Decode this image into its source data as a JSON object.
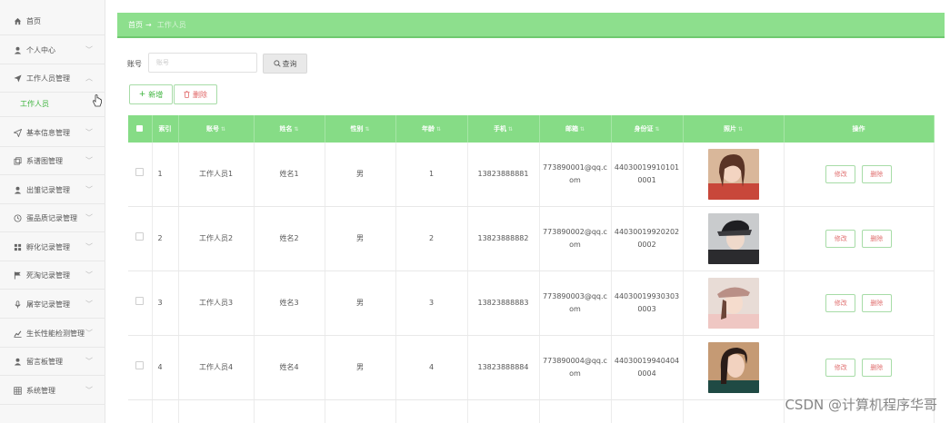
{
  "sidebar": {
    "items": [
      {
        "label": "首页",
        "icon": "home-icon",
        "chevron": false
      },
      {
        "label": "个人中心",
        "icon": "user-icon",
        "chevron": true
      },
      {
        "label": "工作人员管理",
        "icon": "send-icon",
        "chevron": true,
        "expanded": true
      },
      {
        "label": "基本信息管理",
        "icon": "send-outline-icon",
        "chevron": true
      },
      {
        "label": "系谱图管理",
        "icon": "copy-icon",
        "chevron": true
      },
      {
        "label": "出雏记录管理",
        "icon": "user-icon",
        "chevron": true
      },
      {
        "label": "蛋品质记录管理",
        "icon": "clock-icon",
        "chevron": true
      },
      {
        "label": "孵化记录管理",
        "icon": "grid-icon",
        "chevron": true
      },
      {
        "label": "死淘记录管理",
        "icon": "flag-icon",
        "chevron": true
      },
      {
        "label": "屠宰记录管理",
        "icon": "mic-icon",
        "chevron": true
      },
      {
        "label": "生长性能检测管理",
        "icon": "chart-icon",
        "chevron": true
      },
      {
        "label": "留言板管理",
        "icon": "user-icon",
        "chevron": true
      },
      {
        "label": "系统管理",
        "icon": "table-icon",
        "chevron": true
      }
    ],
    "sub_item": "工作人员"
  },
  "breadcrumb": {
    "home": "首页",
    "arrow": "→",
    "current": "工作人员"
  },
  "search": {
    "label": "账号",
    "placeholder": "账号",
    "button": "查询"
  },
  "toolbar": {
    "add": "新增",
    "delete": "删除"
  },
  "table": {
    "columns": [
      "索引",
      "账号",
      "姓名",
      "性别",
      "年龄",
      "手机",
      "邮箱",
      "身份证",
      "照片",
      "操作"
    ],
    "rows": [
      {
        "index": "1",
        "account": "工作人员1",
        "name": "姓名1",
        "gender": "男",
        "age": "1",
        "phone": "13823888881",
        "email": "773890001@qq.com",
        "idcard": "440300199101010001"
      },
      {
        "index": "2",
        "account": "工作人员2",
        "name": "姓名2",
        "gender": "男",
        "age": "2",
        "phone": "13823888882",
        "email": "773890002@qq.com",
        "idcard": "440300199202020002"
      },
      {
        "index": "3",
        "account": "工作人员3",
        "name": "姓名3",
        "gender": "男",
        "age": "3",
        "phone": "13823888883",
        "email": "773890003@qq.com",
        "idcard": "440300199303030003"
      },
      {
        "index": "4",
        "account": "工作人员4",
        "name": "姓名4",
        "gender": "男",
        "age": "4",
        "phone": "13823888884",
        "email": "773890004@qq.com",
        "idcard": "440300199404040004"
      }
    ],
    "actions": {
      "edit": "修改",
      "delete": "删除"
    }
  },
  "watermark": "CSDN @计算机程序华哥",
  "colors": {
    "accent": "#86dc86",
    "breadcrumb": "#8ddf8d",
    "active": "#3bb33b",
    "danger": "#e06464"
  }
}
